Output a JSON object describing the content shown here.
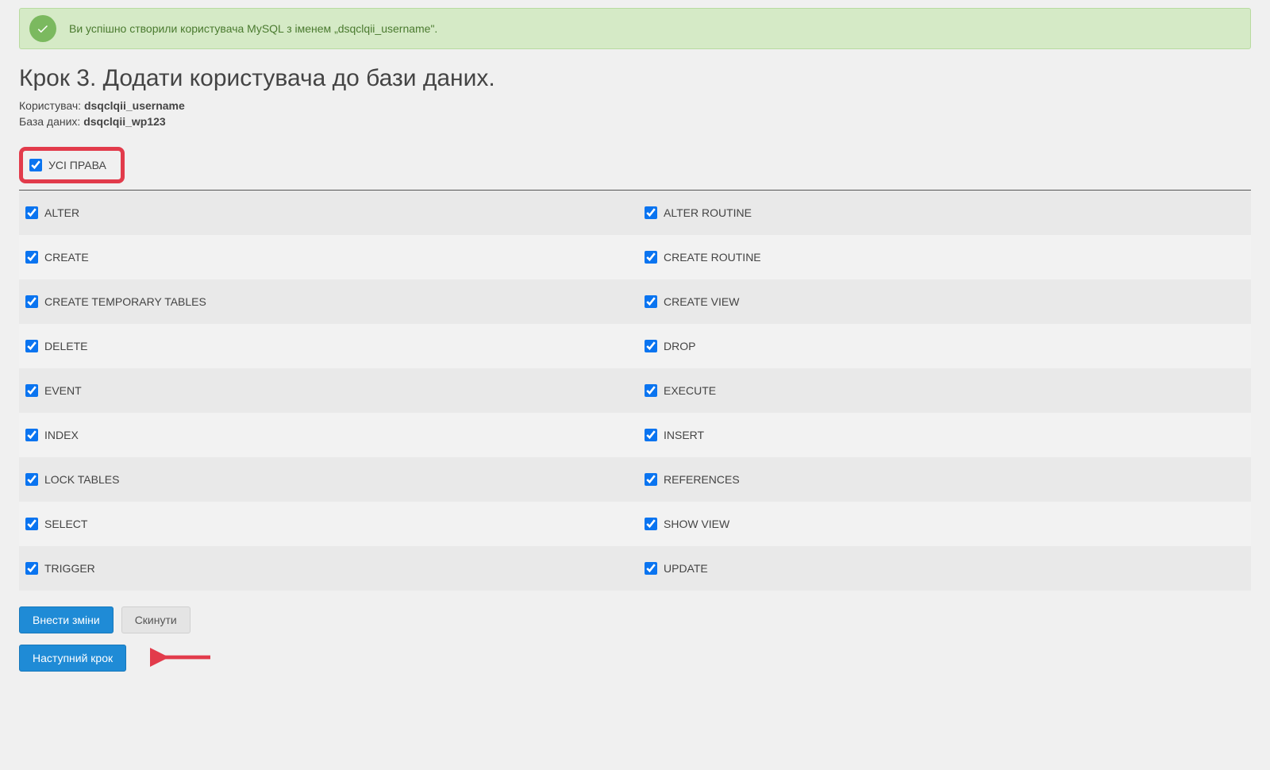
{
  "alert": {
    "message": "Ви успішно створили користувача MySQL з іменем „dsqclqii_username\"."
  },
  "title": "Крок 3. Додати користувача до бази даних.",
  "user_label": "Користувач: ",
  "user_value": "dsqclqii_username",
  "db_label": "База даних: ",
  "db_value": "dsqclqii_wp123",
  "all_priv_label": "УСІ ПРАВА",
  "privileges": {
    "rows": [
      {
        "left": "ALTER",
        "right": "ALTER ROUTINE"
      },
      {
        "left": "CREATE",
        "right": "CREATE ROUTINE"
      },
      {
        "left": "CREATE TEMPORARY TABLES",
        "right": "CREATE VIEW"
      },
      {
        "left": "DELETE",
        "right": "DROP"
      },
      {
        "left": "EVENT",
        "right": "EXECUTE"
      },
      {
        "left": "INDEX",
        "right": "INSERT"
      },
      {
        "left": "LOCK TABLES",
        "right": "REFERENCES"
      },
      {
        "left": "SELECT",
        "right": "SHOW VIEW"
      },
      {
        "left": "TRIGGER",
        "right": "UPDATE"
      }
    ]
  },
  "buttons": {
    "apply": "Внести зміни",
    "reset": "Скинути",
    "next": "Наступний крок"
  }
}
